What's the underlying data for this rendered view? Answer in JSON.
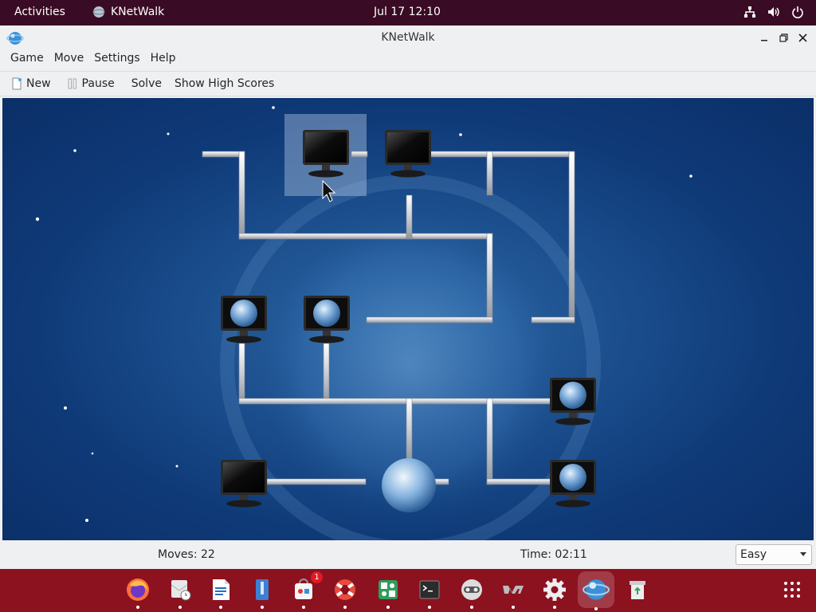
{
  "topbar": {
    "activities": "Activities",
    "app_name": "KNetWalk",
    "clock": "Jul 17  12:10"
  },
  "window": {
    "title": "KNetWalk"
  },
  "menubar": {
    "items": [
      {
        "label": "Game"
      },
      {
        "label": "Move"
      },
      {
        "label": "Settings"
      },
      {
        "label": "Help"
      }
    ]
  },
  "toolbar": {
    "new_label": "New",
    "pause_label": "Pause",
    "solve_label": "Solve",
    "highscores_label": "Show High Scores"
  },
  "status": {
    "moves": "Moves: 22",
    "time": "Time: 02:11",
    "difficulty": "Easy"
  },
  "dock": {
    "items": [
      {
        "icon": "firefox-icon"
      },
      {
        "icon": "mail-clock-icon"
      },
      {
        "icon": "writer-document-icon"
      },
      {
        "icon": "archive-files-icon"
      },
      {
        "icon": "software-store-icon",
        "badge": "1"
      },
      {
        "icon": "help-lifebuoy-icon"
      },
      {
        "icon": "mahjongg-game-icon"
      },
      {
        "icon": "terminal-icon"
      },
      {
        "icon": "robot-face-icon"
      },
      {
        "icon": "vim-editor-icon"
      },
      {
        "icon": "settings-gear-icon"
      },
      {
        "icon": "knetwalk-globe-icon"
      },
      {
        "icon": "recycle-bin-icon"
      }
    ]
  },
  "colors": {
    "topbar_bg": "#3a0b24",
    "dock_bg": "#8c1220",
    "board_bg": "#1c4f8e"
  }
}
